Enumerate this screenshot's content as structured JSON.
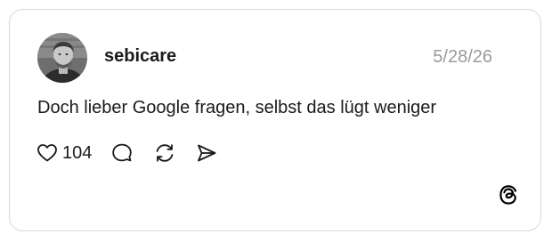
{
  "post": {
    "username": "sebicare",
    "date": "5/28/26",
    "text": "Doch lieber Google fragen, selbst das lügt weniger",
    "like_count": "104"
  },
  "icons": {
    "like": "heart-icon",
    "reply": "comment-bubble-icon",
    "repost": "repost-icon",
    "share": "send-icon",
    "brand": "threads-logo-icon"
  },
  "colors": {
    "text": "#1a1a1a",
    "muted": "#9a9a9a",
    "border": "#d9d9d9"
  }
}
